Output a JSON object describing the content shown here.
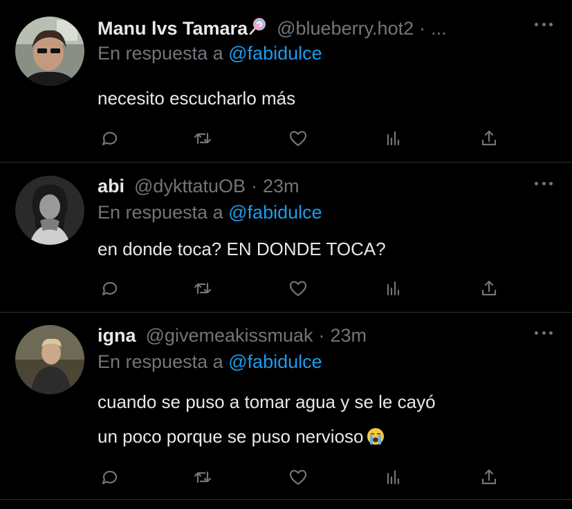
{
  "reply_prefix": "En respuesta a",
  "tweets": [
    {
      "name": "Manu lvs Tamara",
      "name_emoji": "lollipop-emoji",
      "handle": "@blueberry.hot2",
      "dot": "·",
      "time": "...",
      "mention": "@fabidulce",
      "text_lines": [
        "necesito escucharlo más"
      ]
    },
    {
      "name": "abi",
      "handle": "@dykttatuOB",
      "dot": "·",
      "time": "23m",
      "mention": "@fabidulce",
      "text_lines": [
        "en donde toca? EN DONDE TOCA?"
      ]
    },
    {
      "name": "igna",
      "handle": "@givemeakissmuak",
      "dot": "·",
      "time": "23m",
      "mention": "@fabidulce",
      "text_lines": [
        "cuando se puso a tomar agua y se le cayó",
        "un poco porque se puso nervioso"
      ],
      "text_emoji": "loudly-crying-face-emoji"
    }
  ],
  "icons": [
    "comment-icon",
    "retweet-icon",
    "like-icon",
    "analytics-icon",
    "share-icon",
    "more-icon"
  ],
  "colors": {
    "background": "#000000",
    "text": "#e7e9ea",
    "secondary": "#71767b",
    "link": "#1d9bf0",
    "divider": "#2f3336"
  }
}
